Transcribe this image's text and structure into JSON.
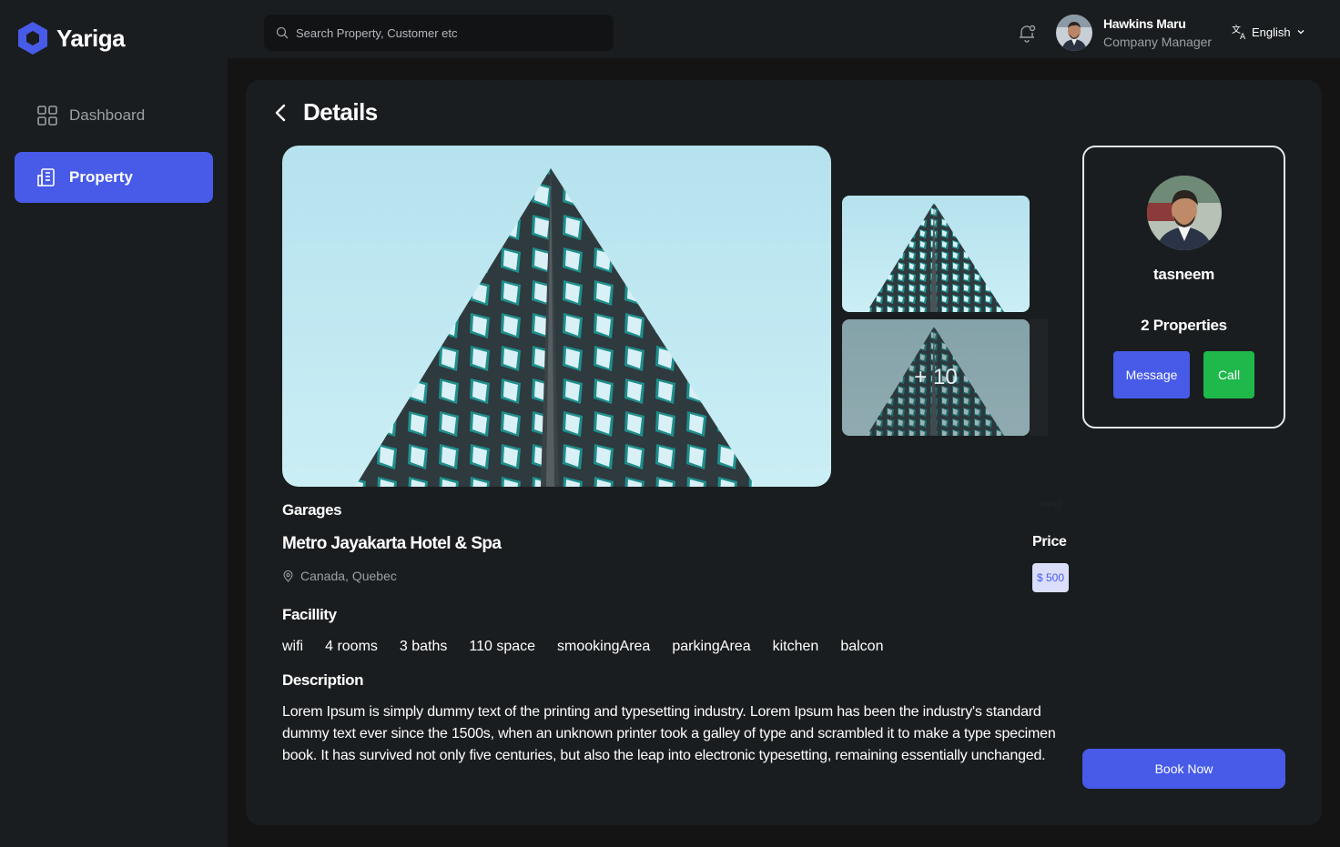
{
  "app": {
    "name": "Yariga"
  },
  "search": {
    "placeholder": "Search Property, Customer etc"
  },
  "user": {
    "name": "Hawkins Maru",
    "role": "Company Manager"
  },
  "language": {
    "selected": "English"
  },
  "sidebar": {
    "items": [
      {
        "label": "Dashboard",
        "icon": "grid-icon",
        "active": false
      },
      {
        "label": "Property",
        "icon": "building-icon",
        "active": true
      }
    ]
  },
  "page": {
    "title": "Details"
  },
  "gallery": {
    "more_count": "+ 10"
  },
  "agent": {
    "name": "tasneem",
    "properties": "2 Properties",
    "message_label": "Message",
    "call_label": "Call"
  },
  "property": {
    "type": "Garages",
    "rating_label": "rating",
    "name": "Metro Jayakarta Hotel & Spa",
    "location": "Canada, Quebec",
    "price_label": "Price",
    "price": "$ 500",
    "facility_title": "Facillity",
    "facilities": [
      "wifi",
      "4 rooms",
      "3 baths",
      "110 space",
      "smookingArea",
      "parkingArea",
      "kitchen",
      "balcon"
    ],
    "description_title": "Description",
    "description": "Lorem Ipsum is simply dummy text of the printing and typesetting industry. Lorem Ipsum has been the industry's standard dummy text ever since the 1500s, when an unknown printer took a galley of type and scrambled it to make a type specimen book. It has survived not only five centuries, but also the leap into electronic typesetting, remaining essentially unchanged."
  },
  "actions": {
    "book_now": "Book Now"
  },
  "colors": {
    "accent": "#475be8",
    "call": "#1fb84a",
    "background": "#141414",
    "panel": "#1a1d1f"
  }
}
